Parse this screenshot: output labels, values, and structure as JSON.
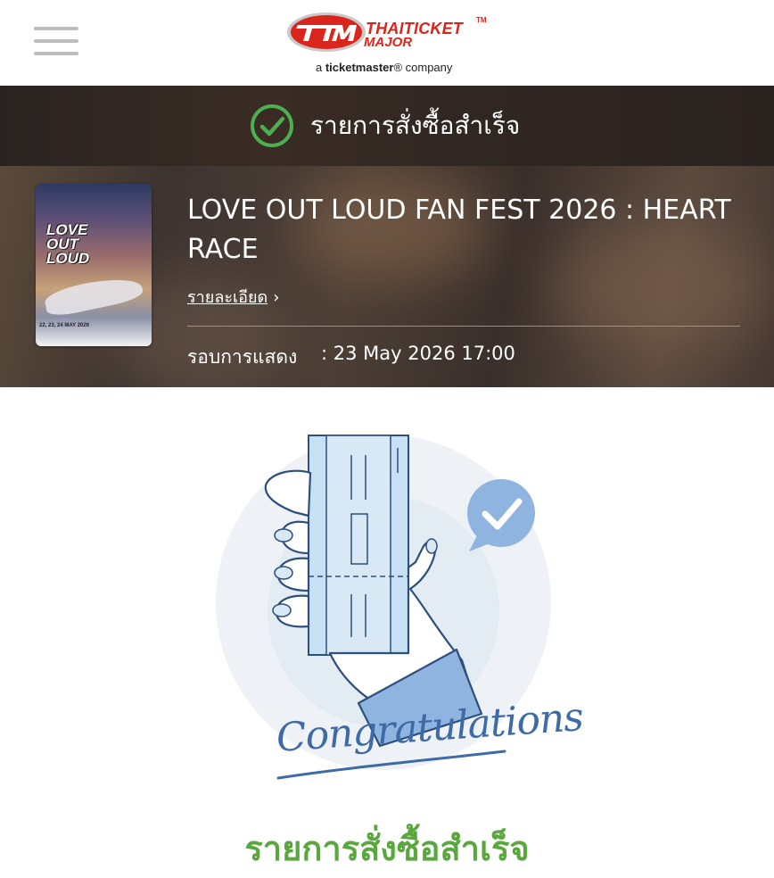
{
  "header": {
    "menu_icon": "hamburger-menu-icon",
    "logo_brand_line1": "THAITICKET",
    "logo_tm": "TM",
    "logo_brand_line2": "MAJOR",
    "logo_tagline_prefix": "a ",
    "logo_tagline_brand": "ticketmaster",
    "logo_tagline_suffix": "® company",
    "logo_color": "#d9251c"
  },
  "status": {
    "icon": "check-circle-icon",
    "text": "รายการสั่งซื้อสำเร็จ",
    "icon_color": "#4caf50"
  },
  "event": {
    "title": "LOVE OUT LOUD FAN FEST 2026 : HEART RACE",
    "detail_link": "รายละเอียด",
    "detail_chevron": "›",
    "show_label": "รอบการแสดง",
    "show_value": ": 23 May 2026 17:00",
    "poster": {
      "title": "LOVE OUT LOUD",
      "dates": "22, 23, 24 MAY 2026"
    }
  },
  "illustration": {
    "name": "hand-holding-ticket-illustration",
    "caption": "Congratulations",
    "accent": "#3e6aa6"
  },
  "footer": {
    "success_text": "รายการสั่งซื้อสำเร็จ",
    "success_color": "#5aa73e"
  }
}
